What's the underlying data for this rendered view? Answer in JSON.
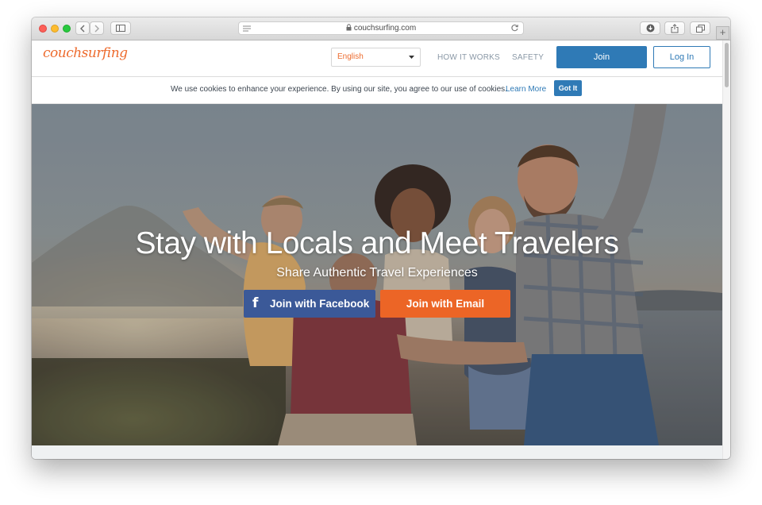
{
  "browser": {
    "url": "couchsurfing.com",
    "new_tab_symbol": "+",
    "icons": [
      "back-icon",
      "forward-icon",
      "sidebar-icon",
      "reader-icon",
      "lock-icon",
      "reload-icon",
      "download-icon",
      "share-icon",
      "tabs-icon"
    ]
  },
  "header": {
    "logo": "couchsurfing",
    "language": "English",
    "nav": {
      "how_it_works": "HOW IT WORKS",
      "safety": "SAFETY"
    },
    "join_label": "Join",
    "login_label": "Log In"
  },
  "cookie": {
    "message": "We use cookies to enhance your experience. By using our site, you agree to our use of cookies.",
    "learn_more": "Learn More",
    "got_it": "Got It"
  },
  "hero": {
    "title": "Stay with Locals and Meet Travelers",
    "subtitle": "Share Authentic Travel Experiences",
    "facebook_icon": "f",
    "facebook_button": "Join with Facebook",
    "email_button": "Join with Email"
  },
  "colors": {
    "brand_orange": "#ed6b2e",
    "primary_blue": "#2f7ab6",
    "facebook_blue": "#3b5998",
    "email_orange": "#ec6526"
  }
}
